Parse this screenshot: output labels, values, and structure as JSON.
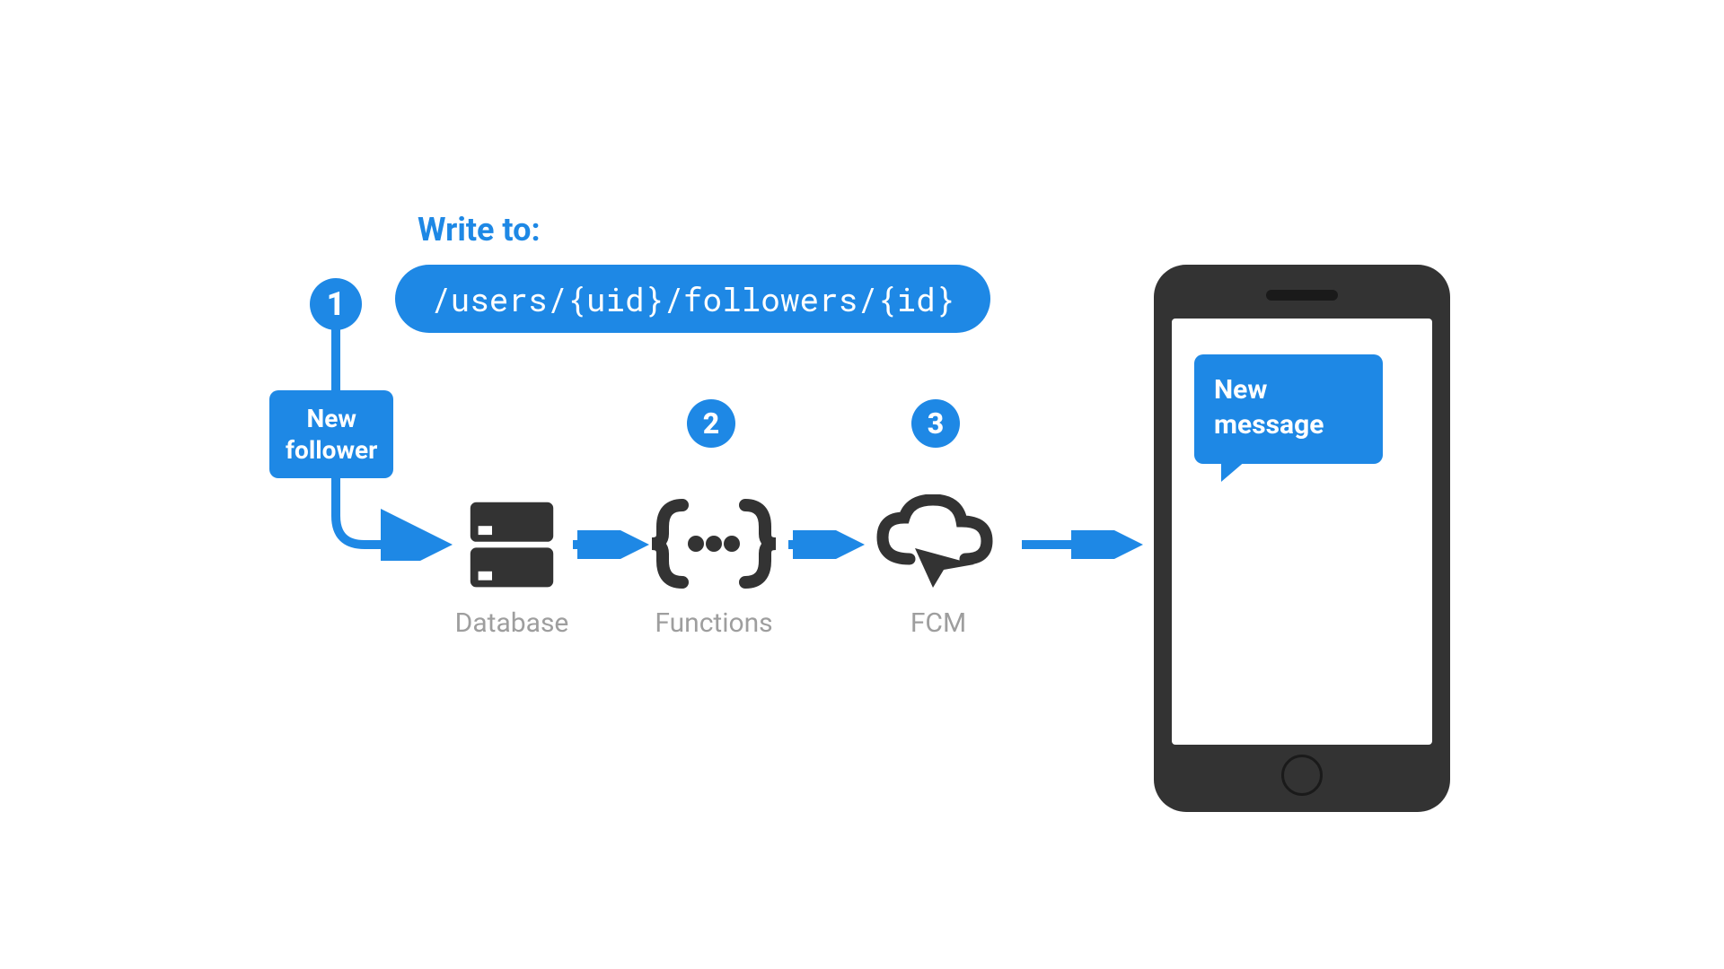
{
  "header": {
    "write_to_label": "Write to:",
    "path": "/users/{uid}/followers/{id}"
  },
  "steps": {
    "one": "1",
    "two": "2",
    "three": "3"
  },
  "new_follower": {
    "line1": "New",
    "line2": "follower"
  },
  "nodes": {
    "database": "Database",
    "functions": "Functions",
    "fcm": "FCM"
  },
  "phone": {
    "msg_line1": "New",
    "msg_line2": "message"
  },
  "colors": {
    "accent": "#1e88e5",
    "dark": "#333333",
    "label": "#9e9e9e"
  }
}
